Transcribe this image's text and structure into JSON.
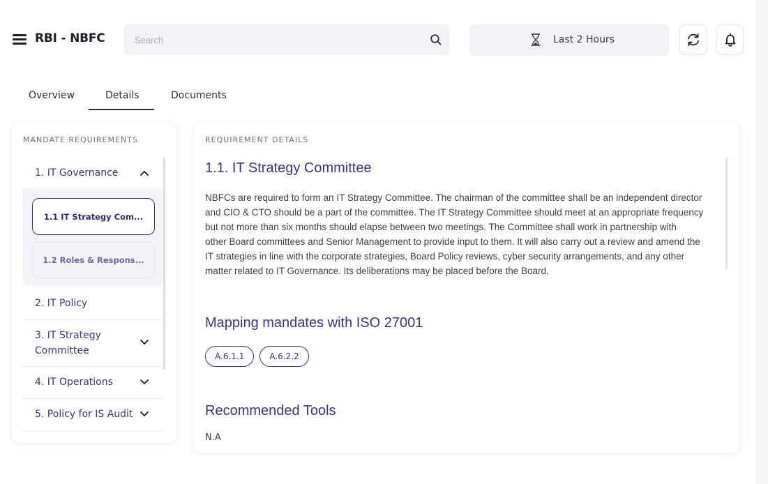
{
  "header": {
    "title": "RBI - NBFC",
    "search_placeholder": "Search",
    "time_range": "Last 2 Hours",
    "icons": [
      "menu-icon",
      "search-icon",
      "hourglass-icon",
      "refresh-icon",
      "bell-icon"
    ]
  },
  "tabs": [
    {
      "label": "Overview",
      "active": false
    },
    {
      "label": "Details",
      "active": true
    },
    {
      "label": "Documents",
      "active": false
    }
  ],
  "left_panel": {
    "heading": "MANDATE REQUIREMENTS",
    "items": [
      {
        "label": "1. IT Governance",
        "expanded": true,
        "children": [
          {
            "label": "1.1 IT Strategy Com...",
            "selected": true
          },
          {
            "label": "1.2 Roles & Respons...",
            "selected": false
          }
        ]
      },
      {
        "label": "2. IT Policy"
      },
      {
        "label": "3. IT Strategy Committee"
      },
      {
        "label": "4. IT Operations"
      },
      {
        "label": "5. Policy for IS Audit"
      }
    ]
  },
  "right_panel": {
    "heading": "REQUIREMENT DETAILS",
    "title": "1.1. IT Strategy Committee",
    "body_lines": [
      "NBFCs are required to form an IT Strategy Committee. The chairman of the committee shall be an independent director",
      "and CIO & CTO should be a part of the committee. The IT Strategy Committee should meet at an appropriate frequency",
      "but not more than six months should elapse between two meetings. The Committee shall work in partnership with",
      "other Board committees and Senior Management to provide input to them. It will also carry out a review and amend the",
      "IT strategies in line with the corporate strategies, Board Policy reviews, cyber security arrangements, and any other",
      "matter related to IT Governance. Its deliberations may be placed before the Board."
    ],
    "mapping_title": "Mapping mandates with ISO 27001",
    "mapping_tags": [
      "A.6.1.1",
      "A.6.2.2"
    ],
    "tools_title": "Recommended Tools",
    "tools_value": "N.A"
  },
  "colors": {
    "accent": "#3a3391",
    "text": "#3e3e48",
    "panel_bg": "#ffffff",
    "input_bg": "#f3f3f7"
  }
}
